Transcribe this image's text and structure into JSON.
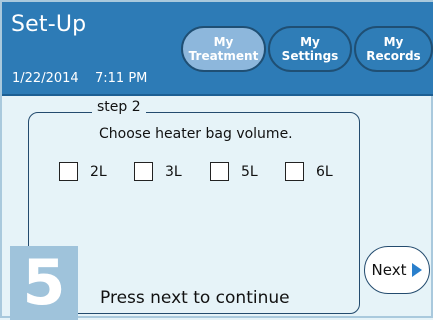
{
  "header": {
    "title": "Set-Up",
    "date": "1/22/2014",
    "time": "7:11 PM",
    "tabs": [
      {
        "line1": "My",
        "line2": "Treatment"
      },
      {
        "line1": "My",
        "line2": "Settings"
      },
      {
        "line1": "My",
        "line2": "Records"
      }
    ]
  },
  "step": {
    "label": "step 2",
    "prompt": "Choose heater bag volume.",
    "options": [
      {
        "label": "2L"
      },
      {
        "label": "3L"
      },
      {
        "label": "5L"
      },
      {
        "label": "6L"
      }
    ],
    "number": "5",
    "hint": "Press next to continue"
  },
  "next_label": "Next",
  "colors": {
    "header_bg": "#2d7bb6",
    "active_tab": "#8db7dc",
    "page_bg": "#e6f3f8",
    "step_badge": "#9fc3db",
    "next_arrow": "#2a7fcc"
  },
  "icons": {
    "next": "triangle-right-icon"
  }
}
